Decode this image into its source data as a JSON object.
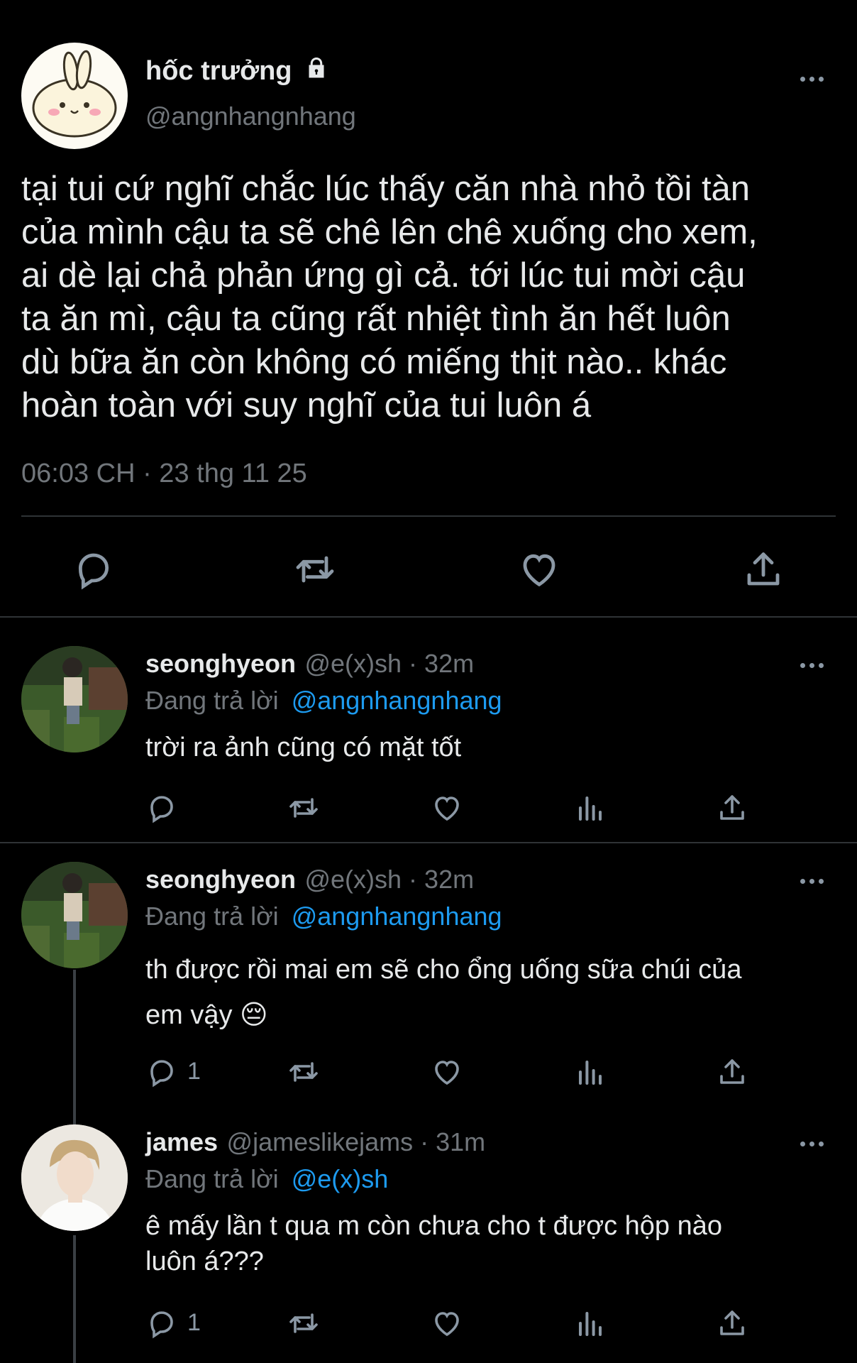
{
  "main_tweet": {
    "display_name": "hốc trưởng",
    "handle": "@angnhangnhang",
    "text": "tại tui cứ nghĩ chắc lúc thấy căn nhà nhỏ tồi tàn của mình cậu ta sẽ chê lên chê xuống cho xem, ai dè lại chả phản ứng gì cả. tới lúc tui mời cậu ta ăn mì, cậu ta cũng rất nhiệt tình ăn hết luôn dù bữa ăn còn không có miếng thịt nào.. khác hoàn toàn với suy nghĩ của tui luôn á",
    "text_lines": [
      "tại tui cứ nghĩ chắc lúc thấy căn nhà nhỏ tồi tàn",
      "của mình cậu ta sẽ chê lên chê xuống cho xem,",
      "ai dè lại chả phản ứng gì cả. tới lúc tui mời cậu",
      "ta ăn mì, cậu ta cũng rất nhiệt tình ăn hết luôn",
      "dù bữa ăn còn không có miếng thịt nào.. khác",
      "hoàn toàn với suy nghĩ của tui luôn á"
    ],
    "timestamp": "06:03 CH · 23 thg 11 25",
    "lock_icon": "lock-icon"
  },
  "replies": [
    {
      "display_name": "seonghyeon",
      "meta": "@e(x)sh · 32m",
      "replying_prefix": "Đang trả lời",
      "replying_to": "@angnhangnhang",
      "text": "trời ra ảnh cũng có mặt tốt",
      "reply_count": ""
    },
    {
      "display_name": "seonghyeon",
      "meta": "@e(x)sh · 32m",
      "replying_prefix": "Đang trả lời",
      "replying_to": "@angnhangnhang",
      "text_line1": "th được rồi mai em sẽ cho ổng uống sữa chúi của",
      "text_line2": "em vậy 😔",
      "reply_count": "1"
    },
    {
      "display_name": "james",
      "meta": "@jameslikejams · 31m",
      "replying_prefix": "Đang trả lời",
      "replying_to": "@e(x)sh",
      "text_line1": "ê mấy lần t qua m còn chưa cho t được hộp nào",
      "text_line2": "luôn á???",
      "reply_count": "1"
    }
  ],
  "colors": {
    "background": "#000000",
    "text": "#e7e9ea",
    "muted": "#71767b",
    "link": "#1d9bf0",
    "divider": "#2f3336"
  }
}
